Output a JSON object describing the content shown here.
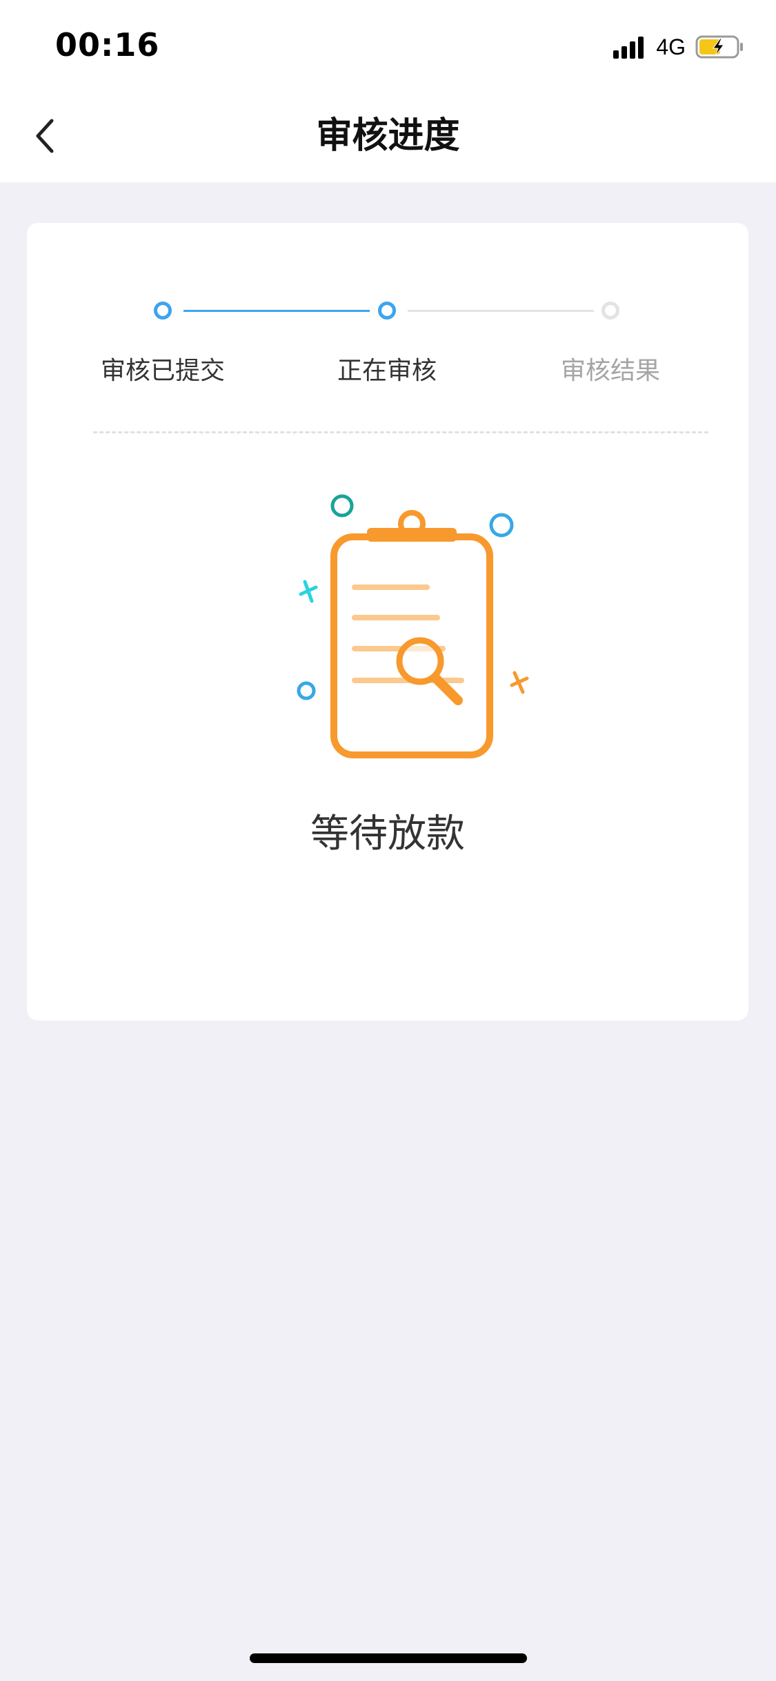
{
  "status_bar": {
    "time": "00:16",
    "network": "4G",
    "battery_color": "#f5c518"
  },
  "nav": {
    "title": "审核进度",
    "back_icon": "chevron-left-icon"
  },
  "progress": {
    "steps": [
      {
        "label": "审核已提交",
        "state": "done"
      },
      {
        "label": "正在审核",
        "state": "active"
      },
      {
        "label": "审核结果",
        "state": "pending"
      }
    ],
    "accent_color": "#3da4f0",
    "inactive_color": "#e3e3e6"
  },
  "result": {
    "illustration_icon": "clipboard-search-icon",
    "status_text": "等待放款",
    "illustration_color": "#f7992d"
  }
}
